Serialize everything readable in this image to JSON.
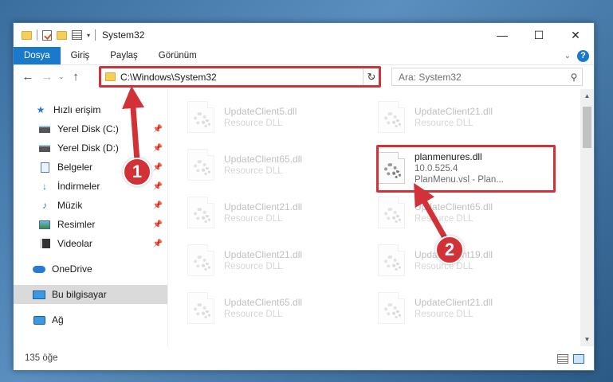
{
  "window": {
    "title": "System32",
    "controls": {
      "minimize": "—",
      "maximize": "☐",
      "close": "✕"
    }
  },
  "ribbon": {
    "tabs": [
      {
        "label": "Dosya",
        "active": true
      },
      {
        "label": "Giriş",
        "active": false
      },
      {
        "label": "Paylaş",
        "active": false
      },
      {
        "label": "Görünüm",
        "active": false
      }
    ],
    "help": "?"
  },
  "navigation": {
    "back": "←",
    "forward": "→",
    "recent": "⌄",
    "up": "↑",
    "address": "C:\\Windows\\System32",
    "refresh": "↻",
    "search_placeholder": "Ara: System32"
  },
  "sidebar": {
    "quick_access": "Hızlı erişim",
    "items": [
      {
        "label": "Yerel Disk (C:)",
        "icon": "drive-icon",
        "pinned": true
      },
      {
        "label": "Yerel Disk (D:)",
        "icon": "drive-icon",
        "pinned": true
      },
      {
        "label": "Belgeler",
        "icon": "documents-icon",
        "pinned": true
      },
      {
        "label": "İndirmeler",
        "icon": "downloads-icon",
        "pinned": true
      },
      {
        "label": "Müzik",
        "icon": "music-icon",
        "pinned": true
      },
      {
        "label": "Resimler",
        "icon": "pictures-icon",
        "pinned": true
      },
      {
        "label": "Videolar",
        "icon": "videos-icon",
        "pinned": true
      }
    ],
    "onedrive": "OneDrive",
    "this_pc": "Bu bilgisayar",
    "network": "Ağ"
  },
  "files": {
    "left_column": [
      {
        "name": "UpdateClient5.dll",
        "type": "Resource DLL"
      },
      {
        "name": "UpdateClient65.dll",
        "type": "Resource DLL"
      },
      {
        "name": "UpdateClient21.dll",
        "type": "Resource DLL"
      },
      {
        "name": "UpdateClient21.dll",
        "type": "Resource DLL"
      },
      {
        "name": "UpdateClient65.dll",
        "type": "Resource DLL"
      }
    ],
    "right_column": [
      {
        "name": "UpdateClient21.dll",
        "type": "Resource DLL"
      },
      {
        "name": "planmenures.dll",
        "version": "10.0.525.4",
        "description": "PlanMenu.vsl - Plan..."
      },
      {
        "name": "UpdateClient65.dll",
        "type": "Resource DLL"
      },
      {
        "name": "UpdateClient19.dll",
        "type": "Resource DLL"
      },
      {
        "name": "UpdateClient21.dll",
        "type": "Resource DLL"
      }
    ]
  },
  "status": {
    "item_count": "135 öğe"
  },
  "callouts": {
    "one": "1",
    "two": "2"
  },
  "colors": {
    "accent": "#1979ca",
    "highlight": "#d23237"
  }
}
